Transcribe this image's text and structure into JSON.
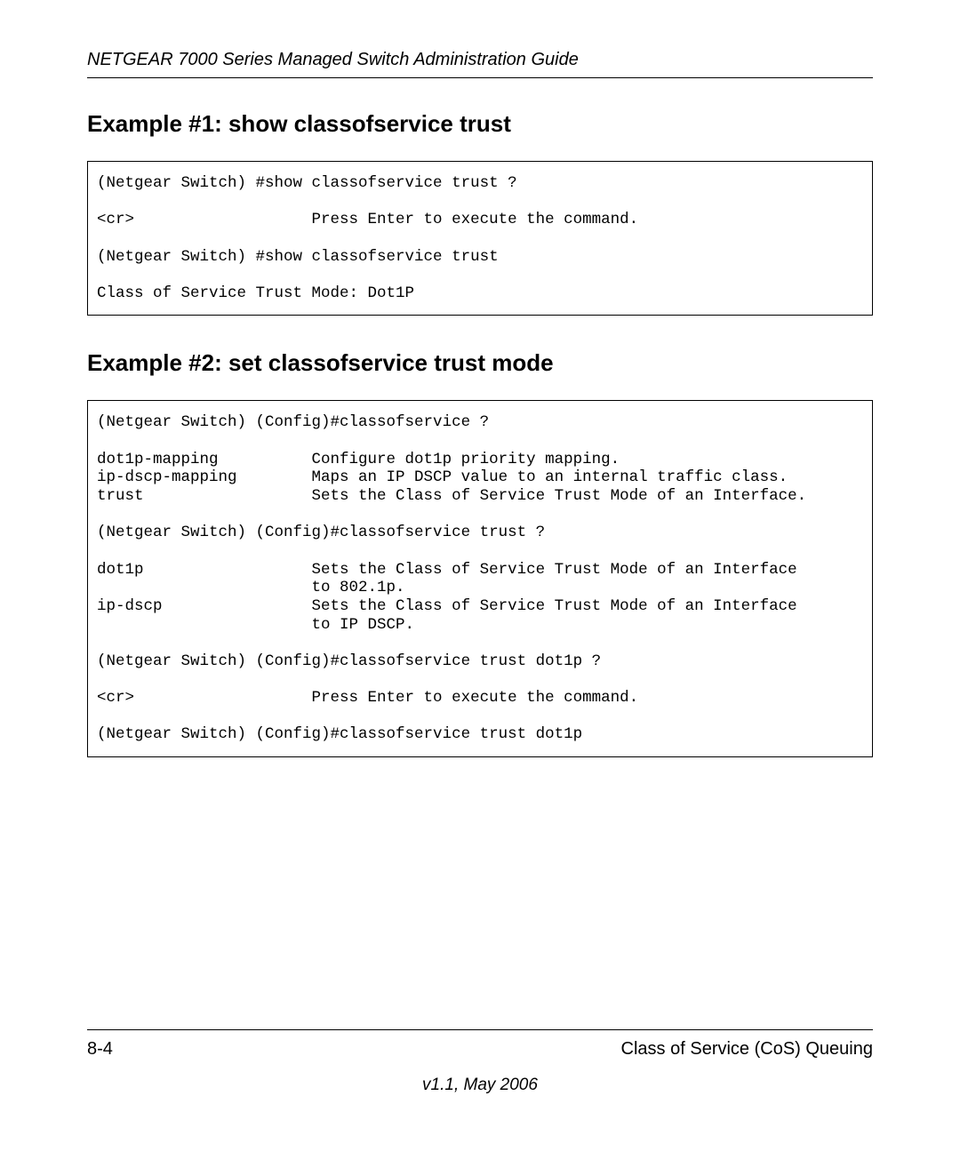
{
  "header": {
    "running_title": "NETGEAR 7000  Series Managed Switch Administration Guide"
  },
  "sections": {
    "example1": {
      "heading": "Example #1: show classofservice trust",
      "code": "(Netgear Switch) #show classofservice trust ?\n\n<cr>                   Press Enter to execute the command.\n\n(Netgear Switch) #show classofservice trust\n\nClass of Service Trust Mode: Dot1P\n"
    },
    "example2": {
      "heading": "Example #2: set classofservice trust mode",
      "code": "(Netgear Switch) (Config)#classofservice ?\n\ndot1p-mapping          Configure dot1p priority mapping.\nip-dscp-mapping        Maps an IP DSCP value to an internal traffic class.\ntrust                  Sets the Class of Service Trust Mode of an Interface.\n\n(Netgear Switch) (Config)#classofservice trust ?\n\ndot1p                  Sets the Class of Service Trust Mode of an Interface\n                       to 802.1p.\nip-dscp                Sets the Class of Service Trust Mode of an Interface\n                       to IP DSCP.\n\n(Netgear Switch) (Config)#classofservice trust dot1p ?\n\n<cr>                   Press Enter to execute the command.\n\n(Netgear Switch) (Config)#classofservice trust dot1p\n"
    }
  },
  "footer": {
    "page_number": "8-4",
    "chapter": "Class of Service (CoS) Queuing",
    "version": "v1.1, May 2006"
  }
}
